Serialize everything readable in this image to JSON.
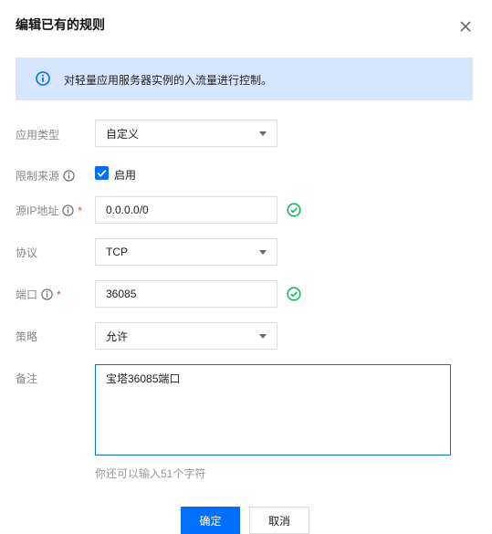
{
  "dialog": {
    "title": "编辑已有的规则",
    "close_icon": "close-icon"
  },
  "notice": {
    "icon": "info-icon",
    "text": "对轻量应用服务器实例的入流量进行控制。",
    "background": "#d5e7fe",
    "accent": "#006eff"
  },
  "form": {
    "app_type": {
      "label": "应用类型",
      "value": "自定义"
    },
    "limit_source": {
      "label": "限制来源",
      "checkbox_label": "启用",
      "checked": true
    },
    "source_ip": {
      "label": "源IP地址",
      "value": "0.0.0.0/0",
      "required": "*"
    },
    "protocol": {
      "label": "协议",
      "value": "TCP"
    },
    "port": {
      "label": "端口",
      "value": "36085",
      "required": "*"
    },
    "policy": {
      "label": "策略",
      "value": "允许"
    },
    "remark": {
      "label": "备注",
      "value": "宝塔36085端口",
      "hint": "你还可以输入51个字符"
    }
  },
  "footer": {
    "confirm_label": "确定",
    "cancel_label": "取消"
  },
  "colors": {
    "primary": "#006eff",
    "success": "#0abf5b",
    "required": "#e54545"
  }
}
